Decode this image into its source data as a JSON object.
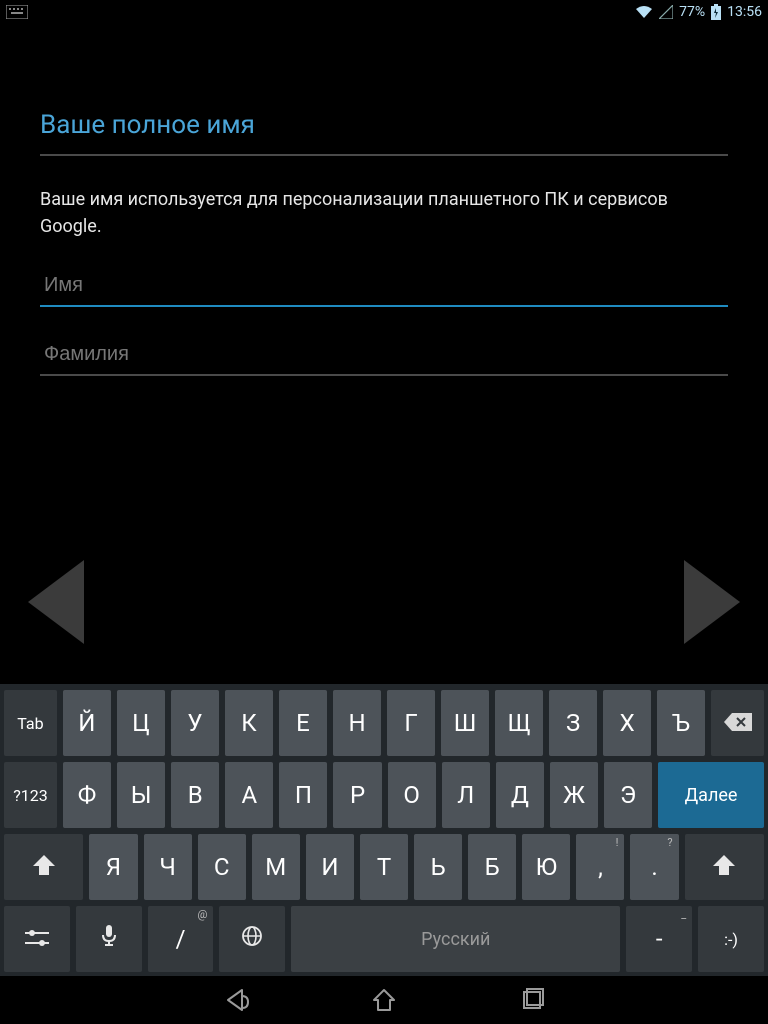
{
  "statusbar": {
    "battery": "77%",
    "time": "13:56"
  },
  "form": {
    "title": "Ваше полное имя",
    "description": "Ваше имя используется для персонализации планшетного ПК и сервисов Google.",
    "first_name_placeholder": "Имя",
    "last_name_placeholder": "Фамилия",
    "first_name_value": "",
    "last_name_value": ""
  },
  "keyboard": {
    "tab": "Tab",
    "sym": "?123",
    "enter": "Далее",
    "space": "Русский",
    "slash": "/",
    "slash_sub": "@",
    "dash": "-",
    "dash_sub": "_",
    "comma": ",",
    "comma_sub": "!",
    "period": ".",
    "period_sub": "?",
    "smile": ":-)",
    "row1": [
      "Й",
      "Ц",
      "У",
      "К",
      "Е",
      "Н",
      "Г",
      "Ш",
      "Щ",
      "З",
      "Х",
      "Ъ"
    ],
    "row2": [
      "Ф",
      "Ы",
      "В",
      "А",
      "П",
      "Р",
      "О",
      "Л",
      "Д",
      "Ж",
      "Э"
    ],
    "row3": [
      "Я",
      "Ч",
      "С",
      "М",
      "И",
      "Т",
      "Ь",
      "Б",
      "Ю"
    ]
  }
}
